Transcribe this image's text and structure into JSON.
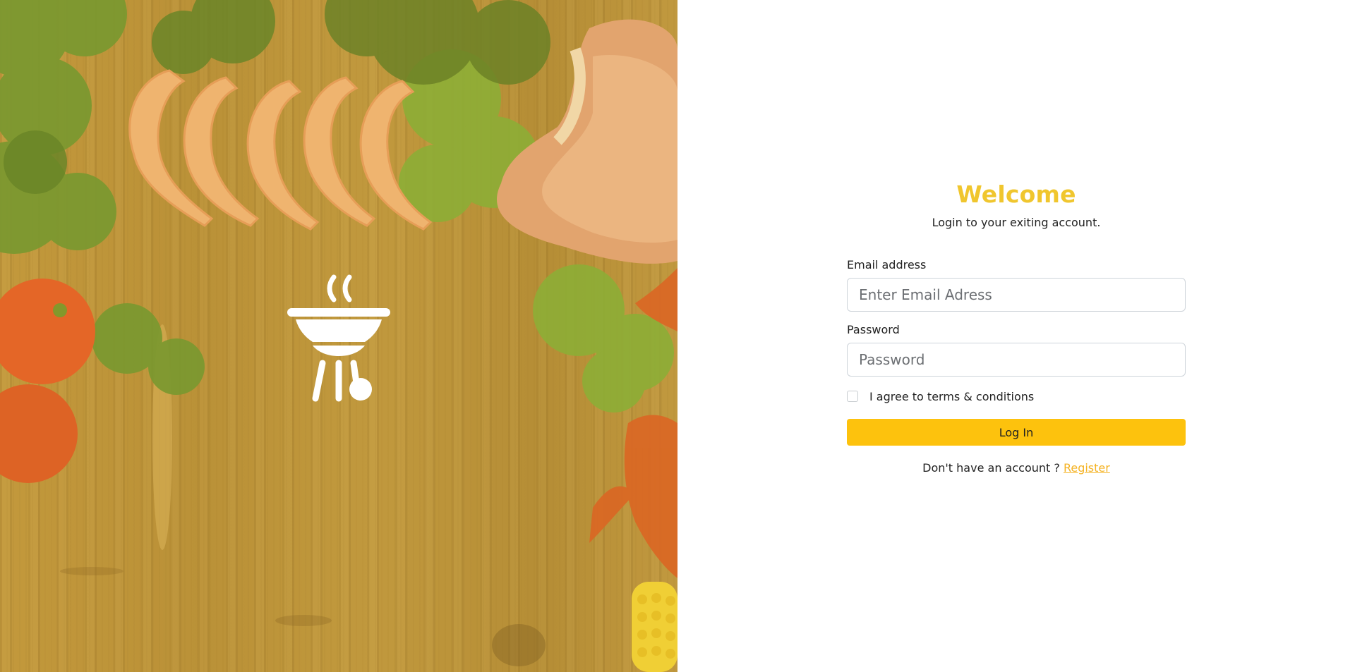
{
  "hero": {
    "logo_icon": "barbecue-grill-icon",
    "overlay_color": "#e8be3c"
  },
  "login": {
    "title": "Welcome",
    "subtitle": "Login to your exiting account.",
    "email": {
      "label": "Email address",
      "placeholder": "Enter Email Adress",
      "value": ""
    },
    "password": {
      "label": "Password",
      "placeholder": "Password",
      "value": ""
    },
    "terms": {
      "label": "I agree to terms & conditions",
      "checked": false
    },
    "submit_label": "Log In",
    "register_prompt": "Don't have an account ?",
    "register_link": "Register"
  },
  "colors": {
    "accent_title": "#f0c62e",
    "button": "#fdc20d",
    "link": "#f5b324"
  }
}
